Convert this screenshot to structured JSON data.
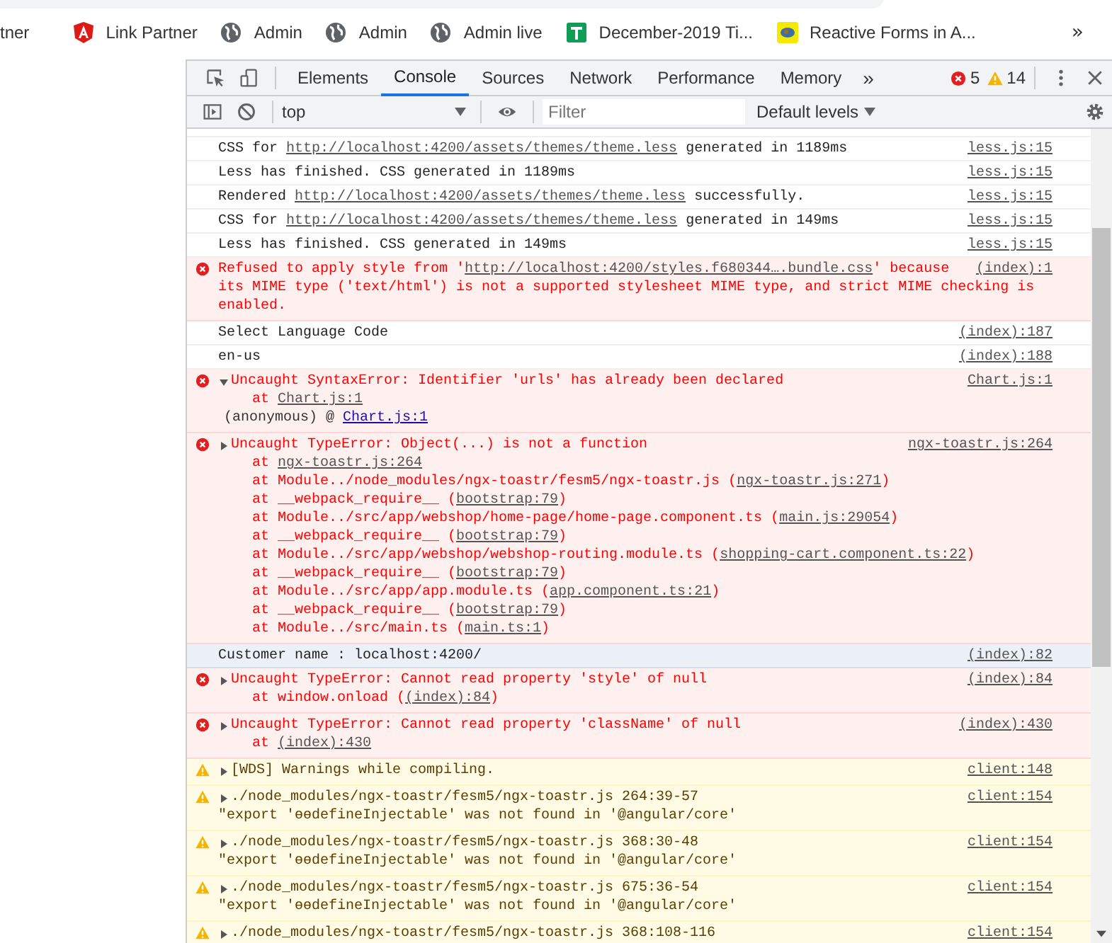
{
  "bookmarks": [
    {
      "label": "tner",
      "kind": "plain"
    },
    {
      "label": "Link Partner",
      "kind": "shield"
    },
    {
      "label": "Admin",
      "kind": "globe"
    },
    {
      "label": "Admin",
      "kind": "globe"
    },
    {
      "label": "Admin live",
      "kind": "globe"
    },
    {
      "label": "December-2019 Ti...",
      "kind": "sheet"
    },
    {
      "label": "Reactive Forms in A...",
      "kind": "image"
    }
  ],
  "bookmarks_more": "»",
  "devtools": {
    "tabs": [
      {
        "label": "Elements",
        "selected": false
      },
      {
        "label": "Console",
        "selected": true
      },
      {
        "label": "Sources",
        "selected": false
      },
      {
        "label": "Network",
        "selected": false
      },
      {
        "label": "Performance",
        "selected": false
      },
      {
        "label": "Memory",
        "selected": false
      }
    ],
    "tabs_more": "»",
    "error_count": "5",
    "warning_count": "14"
  },
  "console_toolbar": {
    "context": "top",
    "filter_placeholder": "Filter",
    "levels": "Default levels"
  },
  "messages": [
    {
      "kind": "log",
      "highlighted": false,
      "source": "less.js:15",
      "lines": [
        {
          "indent": false,
          "parts": [
            "CSS for ",
            {
              "link": "http://localhost:4200/assets/themes/theme.less"
            },
            " generated in 1189ms"
          ]
        }
      ]
    },
    {
      "kind": "log",
      "highlighted": false,
      "source": "less.js:15",
      "lines": [
        {
          "indent": false,
          "parts": [
            "Less has finished. CSS generated in 1189ms"
          ]
        }
      ]
    },
    {
      "kind": "log",
      "highlighted": false,
      "source": "less.js:15",
      "lines": [
        {
          "indent": false,
          "parts": [
            "Rendered ",
            {
              "link": "http://localhost:4200/assets/themes/theme.less"
            },
            " successfully."
          ]
        }
      ]
    },
    {
      "kind": "log",
      "highlighted": false,
      "source": "less.js:15",
      "lines": [
        {
          "indent": false,
          "parts": [
            "CSS for ",
            {
              "link": "http://localhost:4200/assets/themes/theme.less"
            },
            " generated in 149ms"
          ]
        }
      ]
    },
    {
      "kind": "log",
      "highlighted": false,
      "source": "less.js:15",
      "lines": [
        {
          "indent": false,
          "parts": [
            "Less has finished. CSS generated in 149ms"
          ]
        }
      ]
    },
    {
      "kind": "error",
      "highlighted": false,
      "source": "(index):1",
      "lines": [
        {
          "indent": false,
          "parts": [
            "Refused to apply style from '",
            {
              "link": "http://localhost:4200/styles.f680344….bundle.css"
            },
            "' because"
          ]
        },
        {
          "indent": false,
          "parts": [
            "its MIME type ('text/html') is not a supported stylesheet MIME type, and strict MIME checking is"
          ]
        },
        {
          "indent": false,
          "parts": [
            "enabled."
          ]
        }
      ]
    },
    {
      "kind": "log",
      "highlighted": false,
      "source": "(index):187",
      "lines": [
        {
          "indent": false,
          "parts": [
            "Select Language Code"
          ]
        }
      ]
    },
    {
      "kind": "log",
      "highlighted": false,
      "source": "(index):188",
      "lines": [
        {
          "indent": false,
          "parts": [
            "en-us"
          ]
        }
      ]
    },
    {
      "kind": "error",
      "highlighted": false,
      "expanded": true,
      "source": "Chart.js:1",
      "lines": [
        {
          "indent": false,
          "parts": [
            "Uncaught SyntaxError: Identifier 'urls' has already been declared"
          ]
        },
        {
          "indent": true,
          "parts": [
            "at ",
            {
              "link": "Chart.js:1"
            }
          ]
        }
      ],
      "call_site": {
        "name": "(anonymous)",
        "at": "@",
        "link": "Chart.js:1"
      }
    },
    {
      "kind": "error",
      "highlighted": false,
      "expanded": false,
      "source": "ngx-toastr.js:264",
      "lines": [
        {
          "indent": false,
          "parts": [
            "Uncaught TypeError: Object(...) is not a function"
          ]
        },
        {
          "indent": true,
          "parts": [
            "at ",
            {
              "link": "ngx-toastr.js:264"
            }
          ]
        },
        {
          "indent": true,
          "parts": [
            "at Module../node_modules/ngx-toastr/fesm5/ngx-toastr.js (",
            {
              "link": "ngx-toastr.js:271"
            },
            ")"
          ]
        },
        {
          "indent": true,
          "parts": [
            "at __webpack_require__ (",
            {
              "link": "bootstrap:79"
            },
            ")"
          ]
        },
        {
          "indent": true,
          "parts": [
            "at Module../src/app/webshop/home-page/home-page.component.ts (",
            {
              "link": "main.js:29054"
            },
            ")"
          ]
        },
        {
          "indent": true,
          "parts": [
            "at __webpack_require__ (",
            {
              "link": "bootstrap:79"
            },
            ")"
          ]
        },
        {
          "indent": true,
          "parts": [
            "at Module../src/app/webshop/webshop-routing.module.ts (",
            {
              "link": "shopping-cart.component.ts:22"
            },
            ")"
          ]
        },
        {
          "indent": true,
          "parts": [
            "at __webpack_require__ (",
            {
              "link": "bootstrap:79"
            },
            ")"
          ]
        },
        {
          "indent": true,
          "parts": [
            "at Module../src/app/app.module.ts (",
            {
              "link": "app.component.ts:21"
            },
            ")"
          ]
        },
        {
          "indent": true,
          "parts": [
            "at __webpack_require__ (",
            {
              "link": "bootstrap:79"
            },
            ")"
          ]
        },
        {
          "indent": true,
          "parts": [
            "at Module../src/main.ts (",
            {
              "link": "main.ts:1"
            },
            ")"
          ]
        }
      ]
    },
    {
      "kind": "log",
      "highlighted": true,
      "source": "(index):82",
      "lines": [
        {
          "indent": false,
          "parts": [
            "Customer name : localhost:4200/"
          ]
        }
      ]
    },
    {
      "kind": "error",
      "highlighted": false,
      "expanded": false,
      "source": "(index):84",
      "lines": [
        {
          "indent": false,
          "parts": [
            "Uncaught TypeError: Cannot read property 'style' of null"
          ]
        },
        {
          "indent": true,
          "parts": [
            "at window.onload (",
            {
              "link": "(index):84"
            },
            ")"
          ]
        }
      ]
    },
    {
      "kind": "error",
      "highlighted": false,
      "expanded": false,
      "source": "(index):430",
      "lines": [
        {
          "indent": false,
          "parts": [
            "Uncaught TypeError: Cannot read property 'className' of null"
          ]
        },
        {
          "indent": true,
          "parts": [
            "at ",
            {
              "link": "(index):430"
            }
          ]
        }
      ]
    },
    {
      "kind": "warning",
      "highlighted": false,
      "expanded": false,
      "source": "client:148",
      "lines": [
        {
          "indent": false,
          "parts": [
            "[WDS] Warnings while compiling."
          ]
        }
      ]
    },
    {
      "kind": "warning",
      "highlighted": false,
      "expanded": false,
      "source": "client:154",
      "lines": [
        {
          "indent": false,
          "parts": [
            "./node_modules/ngx-toastr/fesm5/ngx-toastr.js 264:39-57"
          ]
        },
        {
          "indent": false,
          "parts": [
            "\"export 'ɵɵdefineInjectable' was not found in '@angular/core'"
          ]
        }
      ]
    },
    {
      "kind": "warning",
      "highlighted": false,
      "expanded": false,
      "source": "client:154",
      "lines": [
        {
          "indent": false,
          "parts": [
            "./node_modules/ngx-toastr/fesm5/ngx-toastr.js 368:30-48"
          ]
        },
        {
          "indent": false,
          "parts": [
            "\"export 'ɵɵdefineInjectable' was not found in '@angular/core'"
          ]
        }
      ]
    },
    {
      "kind": "warning",
      "highlighted": false,
      "expanded": false,
      "source": "client:154",
      "lines": [
        {
          "indent": false,
          "parts": [
            "./node_modules/ngx-toastr/fesm5/ngx-toastr.js 675:36-54"
          ]
        },
        {
          "indent": false,
          "parts": [
            "\"export 'ɵɵdefineInjectable' was not found in '@angular/core'"
          ]
        }
      ]
    },
    {
      "kind": "warning",
      "highlighted": false,
      "expanded": false,
      "source": "client:154",
      "lines": [
        {
          "indent": false,
          "parts": [
            "./node_modules/ngx-toastr/fesm5/ngx-toastr.js 368:108-116"
          ]
        }
      ]
    }
  ]
}
